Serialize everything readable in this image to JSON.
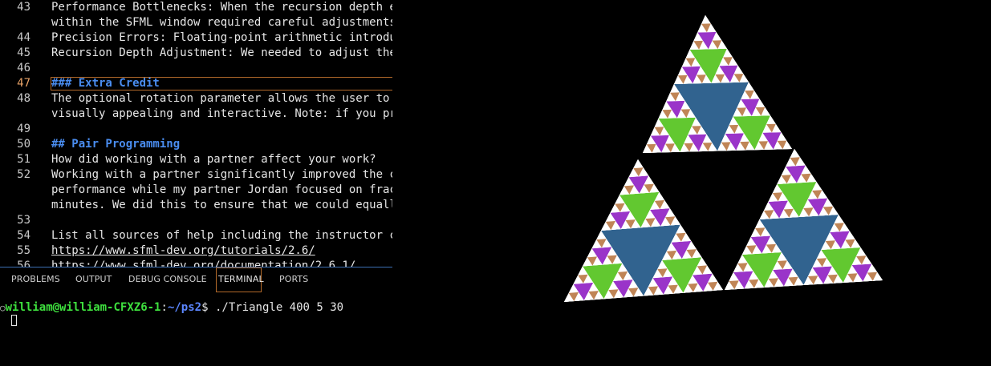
{
  "editor": {
    "lines": [
      {
        "num": "43",
        "text": "Performance Bottlenecks: When the recursion depth e",
        "style": "normal"
      },
      {
        "num": "",
        "text": "within the SFML window required careful adjustments",
        "style": "normal"
      },
      {
        "num": "44",
        "text": "Precision Errors: Floating-point arithmetic introdu",
        "style": "normal"
      },
      {
        "num": "45",
        "text": "Recursion Depth Adjustment: We needed to adjust the",
        "style": "normal"
      },
      {
        "num": "46",
        "text": "",
        "style": "normal"
      },
      {
        "num": "47",
        "text": "### Extra Credit",
        "style": "heading",
        "active": true
      },
      {
        "num": "48",
        "text": "The optional rotation parameter allows the user to ",
        "style": "normal"
      },
      {
        "num": "",
        "text": "visually appealing and interactive. Note: if you pr",
        "style": "normal"
      },
      {
        "num": "49",
        "text": "",
        "style": "normal"
      },
      {
        "num": "50",
        "text": "## Pair Programming",
        "style": "heading"
      },
      {
        "num": "51",
        "text": "How did working with a partner affect your work?",
        "style": "normal"
      },
      {
        "num": "52",
        "text": "Working with a partner significantly improved the c",
        "style": "normal"
      },
      {
        "num": "",
        "text": "performance while my partner Jordan focused on frac",
        "style": "normal"
      },
      {
        "num": "",
        "text": "minutes. We did this to ensure that we could equall",
        "style": "normal"
      },
      {
        "num": "53",
        "text": "",
        "style": "normal"
      },
      {
        "num": "54",
        "text": "List all sources of help including the instructor c",
        "style": "normal"
      },
      {
        "num": "55",
        "text": "https://www.sfml-dev.org/tutorials/2.6/",
        "style": "link"
      },
      {
        "num": "56",
        "text": "https://www.sfml-dev.org/documentation/2.6.1/",
        "style": "link"
      }
    ]
  },
  "panel": {
    "tabs": [
      {
        "label": "PROBLEMS",
        "active": false
      },
      {
        "label": "OUTPUT",
        "active": false
      },
      {
        "label": "DEBUG CONSOLE",
        "active": false
      },
      {
        "label": "TERMINAL",
        "active": true
      },
      {
        "label": "PORTS",
        "active": false
      }
    ]
  },
  "terminal": {
    "status_dot": "○",
    "user_host": "william@william-CFXZ6-1",
    "separator": ":",
    "path": "~/ps2",
    "prompt_symbol": "$",
    "command": "./Triangle 400 5 30"
  },
  "sfml_window": {
    "description_icon": "sierpinski-fractal",
    "colors": {
      "background": "#000000",
      "level0": "#31638f",
      "level1": "#62c830",
      "level2": "#9a34c9",
      "level3": "#c08556",
      "fill": "#ffffff"
    }
  }
}
